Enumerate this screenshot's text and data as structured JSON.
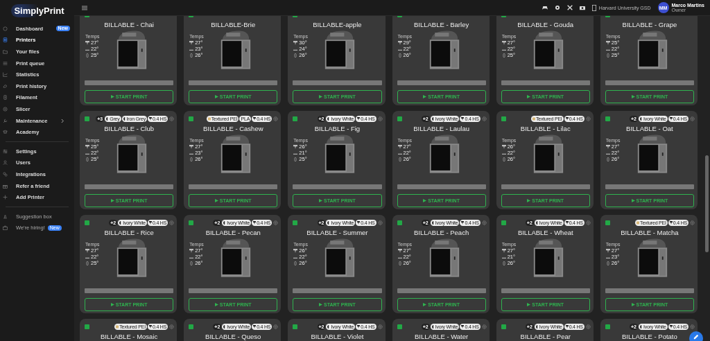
{
  "brand": "SimplyPrint",
  "sidebar": {
    "groups": [
      [
        {
          "label": "Dashboard",
          "selected": false,
          "badge": "New"
        },
        {
          "label": "Printers",
          "selected": true
        },
        {
          "label": "Your files",
          "selected": false
        },
        {
          "label": "Print queue",
          "selected": false
        },
        {
          "label": "Statistics",
          "selected": false
        },
        {
          "label": "Print history",
          "selected": false
        },
        {
          "label": "Filament",
          "selected": false
        },
        {
          "label": "Slicer",
          "selected": false
        },
        {
          "label": "Maintenance",
          "selected": false,
          "expandable": true
        },
        {
          "label": "Academy",
          "selected": false
        }
      ],
      [
        {
          "label": "Settings",
          "selected": false
        },
        {
          "label": "Users",
          "selected": false
        },
        {
          "label": "Integrations",
          "selected": false
        },
        {
          "label": "Refer a friend",
          "selected": false
        },
        {
          "label": "Add Printer",
          "selected": false
        }
      ],
      [
        {
          "label": "Suggestion box",
          "selected": false,
          "muted": true
        },
        {
          "label": "We're hiring!",
          "selected": false,
          "muted": true,
          "badge": "New"
        }
      ]
    ]
  },
  "topbar": {
    "organization": "Harvard University GSD",
    "user": {
      "initials": "MM",
      "name": "Marco Martins",
      "role": "Owner"
    }
  },
  "printers": [
    {
      "name": "BILLABLE - Chai",
      "color": "#22a846",
      "temps_label": "Temps",
      "temps": [
        "27°",
        "22°",
        "25°"
      ],
      "level": 0,
      "button_label": "START PRINT"
    },
    {
      "name": "BILLABLE-Brie",
      "color": "#22a846",
      "temps_label": "Temps",
      "temps": [
        "27°",
        "23°",
        "26°"
      ],
      "level": 0,
      "button_label": "START PRINT"
    },
    {
      "name": "BILLABLE-apple",
      "color": "#22a846",
      "temps_label": "Temps",
      "temps": [
        "30°",
        "24°",
        "26°"
      ],
      "level": 0,
      "button_label": "START PRINT"
    },
    {
      "name": "BILLABLE - Barley",
      "color": "#22a846",
      "temps_label": "Temps",
      "temps": [
        "29°",
        "22°",
        "26°"
      ],
      "level": 0,
      "button_label": "START PRINT"
    },
    {
      "name": "BILLABLE - Gouda",
      "color": "#22a846",
      "temps_label": "Temps",
      "temps": [
        "27°",
        "22°",
        "25°"
      ],
      "level": 0,
      "button_label": "START PRINT"
    },
    {
      "name": "BILLABLE - Grape",
      "color": "#22a846",
      "temps_label": "Temps",
      "temps": [
        "25°",
        "22°",
        "25°"
      ],
      "level": 0,
      "button_label": "START PRINT"
    },
    {
      "name": "BILLABLE - Club",
      "color": "#22a846",
      "extra": "+3",
      "chips": [
        {
          "kind": "filament",
          "label": "Grey"
        },
        {
          "kind": "filament",
          "label": "Iron Grey"
        },
        {
          "kind": "nozzle",
          "label": "0.4 HS"
        }
      ],
      "temps_label": "Temps",
      "temps": [
        "25°",
        "22°",
        "25°"
      ],
      "level": 0,
      "button_label": "START PRINT"
    },
    {
      "name": "BILLABLE - Cashew",
      "color": "#22a846",
      "chips": [
        {
          "kind": "plate",
          "label": "Textured PEI"
        },
        {
          "kind": "material",
          "label": "PLA"
        },
        {
          "kind": "nozzle",
          "label": "0.4 HS"
        }
      ],
      "temps_label": "Temps",
      "temps": [
        "27°",
        "23°",
        "26°"
      ],
      "level": 0,
      "button_label": "START PRINT"
    },
    {
      "name": "BILLABLE - Fig",
      "color": "#22a846",
      "extra": "+2",
      "chips": [
        {
          "kind": "filament",
          "label": "Ivory White"
        },
        {
          "kind": "nozzle",
          "label": "0.4 HS"
        }
      ],
      "temps_label": "Temps",
      "temps": [
        "26°",
        "21°",
        "25°"
      ],
      "level": 0,
      "button_label": "START PRINT"
    },
    {
      "name": "BILLABLE - Laulau",
      "color": "#22a846",
      "extra": "+2",
      "chips": [
        {
          "kind": "filament",
          "label": "Ivory White"
        },
        {
          "kind": "nozzle",
          "label": "0.4 HS"
        }
      ],
      "temps_label": "Temps",
      "temps": [
        "27°",
        "22°",
        "26°"
      ],
      "level": 0,
      "button_label": "START PRINT"
    },
    {
      "name": "BILLABLE - Lilac",
      "color": "#22a846",
      "chips": [
        {
          "kind": "plate",
          "label": "Textured PEI"
        },
        {
          "kind": "nozzle",
          "label": "0.4 HS"
        }
      ],
      "temps_label": "Temps",
      "temps": [
        "26°",
        "22°",
        "26°"
      ],
      "level": 0,
      "button_label": "START PRINT"
    },
    {
      "name": "BILLABLE - Oat",
      "color": "#22a846",
      "extra": "+2",
      "chips": [
        {
          "kind": "filament",
          "label": "Ivory White"
        },
        {
          "kind": "nozzle",
          "label": "0.4 HS"
        }
      ],
      "temps_label": "Temps",
      "temps": [
        "27°",
        "22°",
        "26°"
      ],
      "level": 0,
      "button_label": "START PRINT"
    },
    {
      "name": "BILLABLE - Rice",
      "color": "#22a846",
      "extra": "+2",
      "chips": [
        {
          "kind": "filament",
          "label": "Ivory White"
        },
        {
          "kind": "nozzle",
          "label": "0.4 HS"
        }
      ],
      "temps_label": "Temps",
      "temps": [
        "27°",
        "22°",
        "25°"
      ],
      "level": 0,
      "button_label": "START PRINT"
    },
    {
      "name": "BILLABLE - Pecan",
      "color": "#22a846",
      "extra": "+2",
      "chips": [
        {
          "kind": "filament",
          "label": "Ivory White"
        },
        {
          "kind": "nozzle",
          "label": "0.4 HS"
        }
      ],
      "temps_label": "Temps",
      "temps": [
        "27°",
        "22°",
        "26°"
      ],
      "level": 0,
      "button_label": "START PRINT"
    },
    {
      "name": "BILLABLE - Summer",
      "color": "#22a846",
      "extra": "+2",
      "chips": [
        {
          "kind": "filament",
          "label": "Ivory White"
        },
        {
          "kind": "nozzle",
          "label": "0.4 HS"
        }
      ],
      "temps_label": "Temps",
      "temps": [
        "26°",
        "22°",
        "26°"
      ],
      "level": 0,
      "button_label": "START PRINT"
    },
    {
      "name": "BILLABLE - Peach",
      "color": "#22a846",
      "extra": "+2",
      "chips": [
        {
          "kind": "filament",
          "label": "Ivory White"
        },
        {
          "kind": "nozzle",
          "label": "0.4 HS"
        }
      ],
      "temps_label": "Temps",
      "temps": [
        "27°",
        "22°",
        "26°"
      ],
      "level": 0,
      "button_label": "START PRINT"
    },
    {
      "name": "BILLABLE - Wheat",
      "color": "#22a846",
      "extra": "+2",
      "chips": [
        {
          "kind": "filament",
          "label": "Ivory White"
        },
        {
          "kind": "nozzle",
          "label": "0.4 HS"
        }
      ],
      "temps_label": "Temps",
      "temps": [
        "27°",
        "21°",
        "26°"
      ],
      "level": 0,
      "button_label": "START PRINT"
    },
    {
      "name": "BILLABLE - Matcha",
      "color": "#22a846",
      "chips": [
        {
          "kind": "plate",
          "label": "Textured PEI"
        },
        {
          "kind": "nozzle",
          "label": "0.4 HS"
        }
      ],
      "temps_label": "Temps",
      "temps": [
        "27°",
        "23°",
        "26°"
      ],
      "level": 0,
      "button_label": "START PRINT"
    },
    {
      "name": "BILLABLE - Mosaic",
      "color": "#22a846",
      "chips": [
        {
          "kind": "plate",
          "label": "Textured PEI"
        },
        {
          "kind": "nozzle",
          "label": "0.4 HS"
        }
      ]
    },
    {
      "name": "BILLABLE - Queso",
      "color": "#22a846",
      "extra": "+2",
      "chips": [
        {
          "kind": "filament",
          "label": "Ivory White"
        },
        {
          "kind": "nozzle",
          "label": "0.4 HS"
        }
      ]
    },
    {
      "name": "BILLABLE - Violet",
      "color": "#22a846",
      "extra": "+2",
      "chips": [
        {
          "kind": "filament",
          "label": "Ivory White"
        },
        {
          "kind": "nozzle",
          "label": "0.4 HS"
        }
      ]
    },
    {
      "name": "BILLABLE - Water",
      "color": "#22a846",
      "extra": "+2",
      "chips": [
        {
          "kind": "filament",
          "label": "Ivory White"
        },
        {
          "kind": "nozzle",
          "label": "0.4 HS"
        }
      ]
    },
    {
      "name": "BILLABLE - Pear",
      "color": "#22a846",
      "extra": "+2",
      "chips": [
        {
          "kind": "filament",
          "label": "Ivory White"
        },
        {
          "kind": "nozzle",
          "label": "0.4 HS"
        }
      ]
    },
    {
      "name": "BILLABLE - Potato",
      "color": "#22a846",
      "extra": "+2",
      "chips": [
        {
          "kind": "filament",
          "label": "Ivory White"
        },
        {
          "kind": "nozzle",
          "label": "0.4 HS"
        }
      ]
    }
  ]
}
